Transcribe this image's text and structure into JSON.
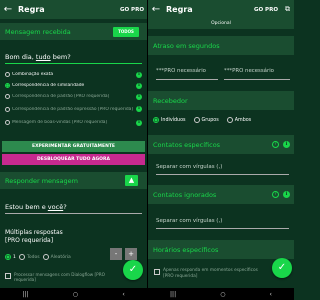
{
  "left": {
    "appbar": {
      "title": "Regra",
      "gopro": "GO PRO"
    },
    "received": {
      "header": "Mensagem recebida",
      "all_button": "TODOS",
      "message_prefix": "Bom dia, ",
      "message_underlined": "tudo",
      "message_suffix": " bem?",
      "options": [
        "Combinação exata",
        "Correspondência de similaridade",
        "Correspondência de padrão [PRO requerida]",
        "Correspondência de padrão expressão [PRO requerida]",
        "Mensagem de boas-vindas [PRO requerida]"
      ],
      "selected_index": 1
    },
    "trial_banner": "EXPERIMENTAR GRATUITAMENTE",
    "unlock_banner": "DESBLOQUEAR TUDO AGORA",
    "reply": {
      "header": "Responder mensagem",
      "message_prefix": "Estou bem e ",
      "message_underlined": "você",
      "message_suffix": "?",
      "multi_title": "Múltiplas respostas",
      "multi_sub": "[PRO requerida]",
      "count": "1",
      "radio_all": "Todos",
      "radio_random": "Aleatória",
      "minus": "-",
      "plus": "+",
      "checkbox_label": "Processar mensagens com Dialogflow [PRO requerida]"
    }
  },
  "right": {
    "appbar": {
      "title": "Regra",
      "gopro": "GO PRO"
    },
    "optional_tab": "Opcional",
    "delay": {
      "header": "Atraso em segundos",
      "field1": "***PRO necessário",
      "field2": "***PRO necessário"
    },
    "recipient": {
      "header": "Recebedor",
      "options": [
        "Indivíduos",
        "Grupos",
        "Ambos"
      ],
      "selected_index": 0
    },
    "specific_contacts": {
      "header": "Contatos específicos",
      "badge": "?",
      "hint": "Separar com vírgulas (,)"
    },
    "ignored_contacts": {
      "header": "Contatos ignorados",
      "badge": "?",
      "hint": "Separar com vírgulas (,)"
    },
    "schedule": {
      "header": "Horários específicos",
      "checkbox_label": "Apenas responda em momentos específicos",
      "checkbox_sub": "[PRO requerida]"
    }
  },
  "nav": {
    "menu": "|||",
    "home": "○",
    "back": "‹"
  },
  "colors": {
    "bg": "#0c3320",
    "header_bg": "#1a4d30",
    "accent": "#19d64a",
    "trial": "#2d8a4e",
    "unlock": "#c62a8f"
  }
}
